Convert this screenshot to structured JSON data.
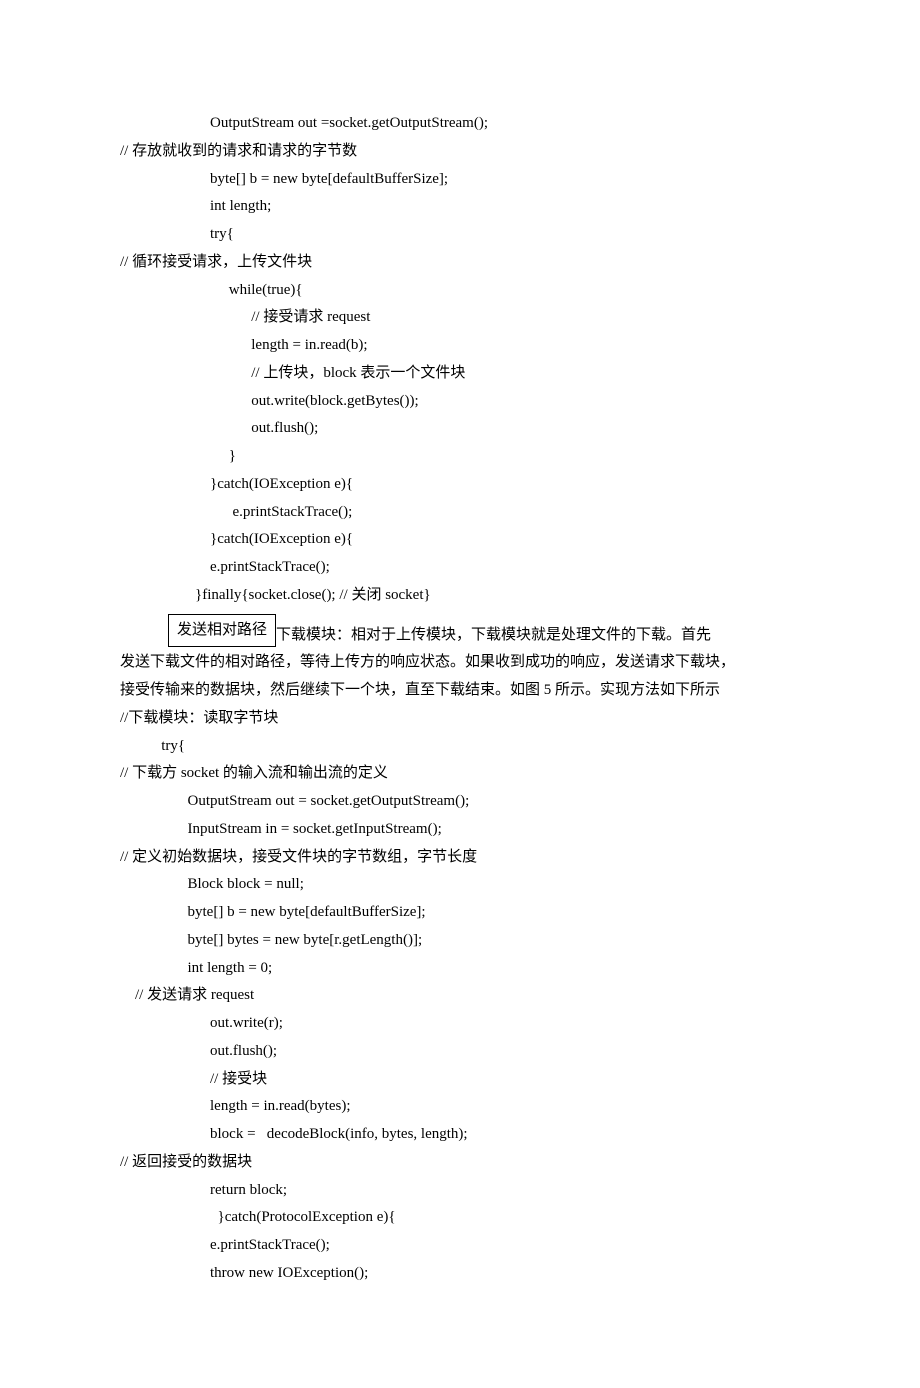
{
  "lines": {
    "l01": "                        OutputStream out =socket.getOutputStream();",
    "l02": "// 存放就收到的请求和请求的字节数",
    "l03": "                        byte[] b = new byte[defaultBufferSize];",
    "l04": "                        int length;",
    "l05": "                        try{",
    "l06": "// 循环接受请求，上传文件块",
    "l07": "                             while(true){",
    "l08": "                                   // 接受请求 request",
    "l09": "                                   length = in.read(b);",
    "l10": "                                   // 上传块，block 表示一个文件块",
    "l11": "                                   out.write(block.getBytes());",
    "l12": "                                   out.flush();",
    "l13": "                             }",
    "l14": "                        }catch(IOException e){",
    "l15": "                              e.printStackTrace();",
    "l16": "                        }catch(IOException e){",
    "l17": "                        e.printStackTrace();",
    "l18": "                    }finally{socket.close(); // 关闭 socket}",
    "box": "发送相对路径",
    "p1a": "下载模块：相对于上传模块，下载模块就是处理文件的下载。首先",
    "p1b": "发送下载文件的相对路径，等待上传方的响应状态。如果收到成功的响应，发送请求下载块，",
    "p1c": "接受传输来的数据块，然后继续下一个块，直至下载结束。如图 5 所示。实现方法如下所示",
    "l19": "//下载模块：读取字节块",
    "l20": "           try{",
    "l21": "// 下载方 socket 的输入流和输出流的定义",
    "l22": "                  OutputStream out = socket.getOutputStream();",
    "l23": "                  InputStream in = socket.getInputStream();",
    "l24": "// 定义初始数据块，接受文件块的字节数组，字节长度",
    "l25": "                  Block block = null;",
    "l26": "                  byte[] b = new byte[defaultBufferSize];",
    "l27": "                  byte[] bytes = new byte[r.getLength()];",
    "l28": "                  int length = 0;",
    "l29": "    // 发送请求 request",
    "l30": "                        out.write(r);",
    "l31": "                        out.flush();",
    "l32": "                        // 接受块",
    "l33": "                        length = in.read(bytes);",
    "l34": "                        block =   decodeBlock(info, bytes, length);",
    "l35": "// 返回接受的数据块",
    "l36": "                        return block;",
    "l37": "                          }catch(ProtocolException e){",
    "l38": "                        e.printStackTrace();",
    "l39": "                        throw new IOException();"
  }
}
